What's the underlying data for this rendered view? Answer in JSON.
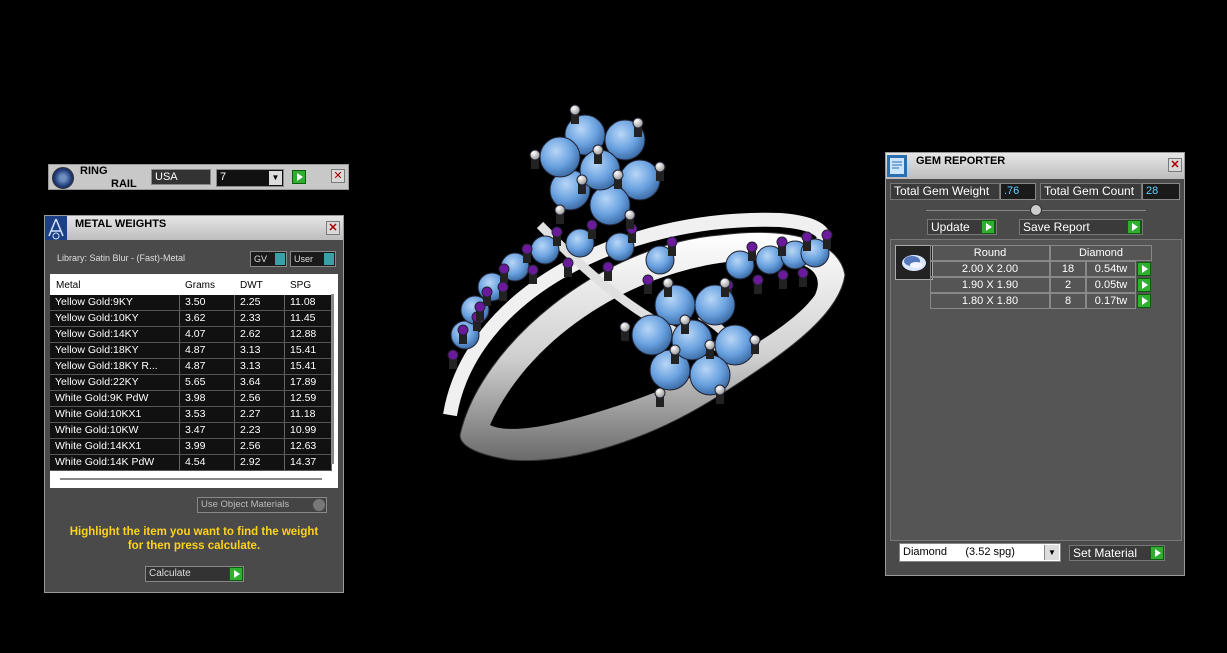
{
  "ring_rail": {
    "title_line1": "RING",
    "title_line2": "RAIL",
    "country": "USA",
    "size": "7"
  },
  "metal_weights": {
    "title": "METAL WEIGHTS",
    "library": "Library: Satin Blur - (Fast)-Metal",
    "toggle_gv": "GV",
    "toggle_user": "User",
    "columns": [
      "Metal",
      "Grams",
      "DWT",
      "SPG"
    ],
    "rows": [
      [
        "Yellow Gold:9KY",
        "3.50",
        "2.25",
        "11.08"
      ],
      [
        "Yellow Gold:10KY",
        "3.62",
        "2.33",
        "11.45"
      ],
      [
        "Yellow Gold:14KY",
        "4.07",
        "2.62",
        "12.88"
      ],
      [
        "Yellow Gold:18KY",
        "4.87",
        "3.13",
        "15.41"
      ],
      [
        "Yellow Gold:18KY R...",
        "4.87",
        "3.13",
        "15.41"
      ],
      [
        "Yellow Gold:22KY",
        "5.65",
        "3.64",
        "17.89"
      ],
      [
        "White Gold:9K PdW",
        "3.98",
        "2.56",
        "12.59"
      ],
      [
        "White Gold:10KX1",
        "3.53",
        "2.27",
        "11.18"
      ],
      [
        "White Gold:10KW",
        "3.47",
        "2.23",
        "10.99"
      ],
      [
        "White Gold:14KX1",
        "3.99",
        "2.56",
        "12.63"
      ],
      [
        "White Gold:14K PdW",
        "4.54",
        "2.92",
        "14.37"
      ]
    ],
    "use_object_materials": "Use Object Materials",
    "instruction": "Highlight the item you want to find the weight for then press calculate.",
    "calculate_label": "Calculate"
  },
  "gem_reporter": {
    "title": "GEM REPORTER",
    "total_weight_label": "Total Gem Weight",
    "total_weight_value": ".76",
    "total_count_label": "Total Gem Count",
    "total_count_value": "28",
    "update_label": "Update",
    "save_report_label": "Save Report",
    "shape_header": "Round",
    "material_header": "Diamond",
    "gems": [
      {
        "size": "2.00 X 2.00",
        "count": "18",
        "weight": "0.54tw"
      },
      {
        "size": "1.90 X 1.90",
        "count": "2",
        "weight": "0.05tw"
      },
      {
        "size": "1.80 X 1.80",
        "count": "8",
        "weight": "0.17tw"
      }
    ],
    "material_select": "Diamond      (3.52 spg)",
    "set_material_label": "Set Material"
  },
  "colors": {
    "panel_bg": "#4a4a4a",
    "accent_green": "#2fae2f",
    "instruction_yellow": "#ffd21a",
    "gem_blue": "#6aa2e0",
    "prong_purple": "#6a1a9a",
    "metal_white": "#e8e8e8"
  }
}
